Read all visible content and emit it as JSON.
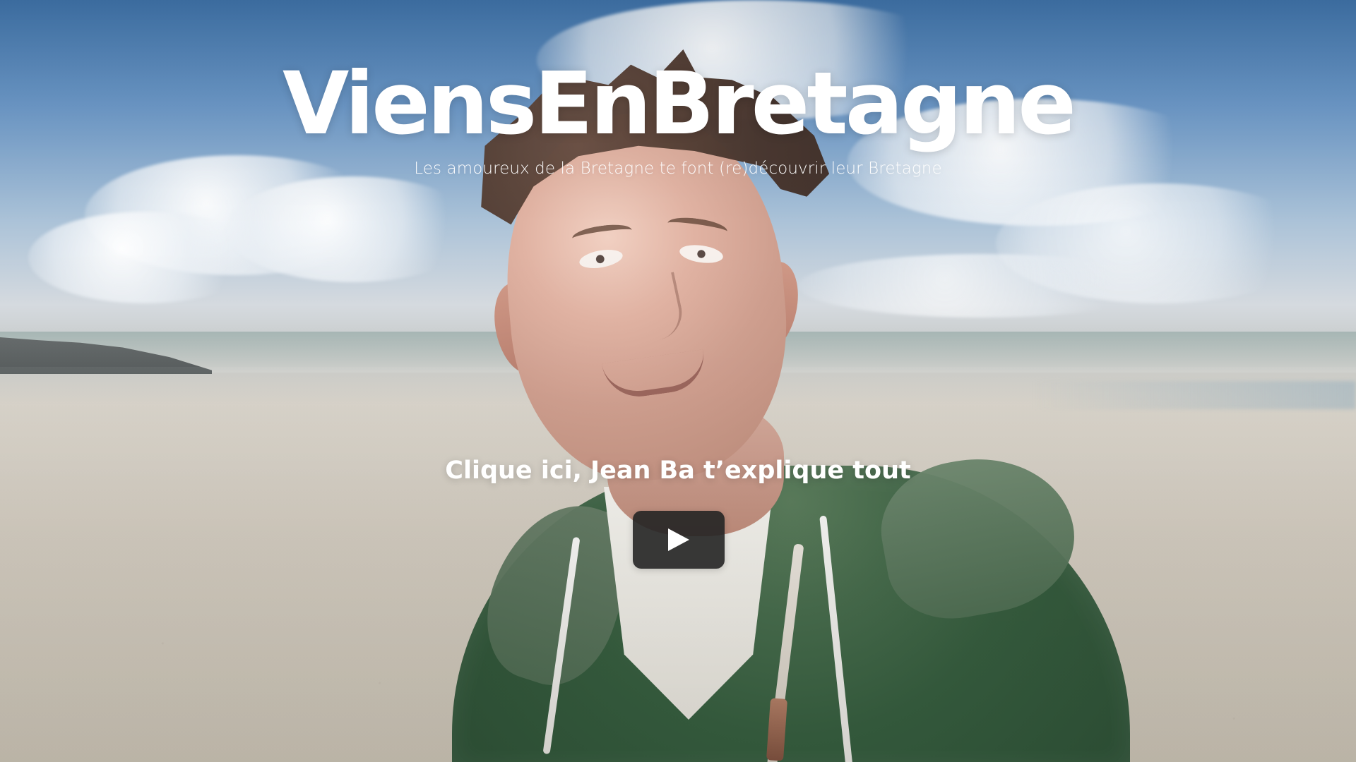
{
  "header": {
    "title": "ViensEnBretagne",
    "subtitle": "Les amoureux de la Bretagne te font (re)découvrir leur Bretagne"
  },
  "hero": {
    "cta_label": "Clique ici, Jean Ba t’explique tout",
    "play_icon": "play-icon",
    "colors": {
      "text": "#ffffff",
      "button": "#232323"
    }
  }
}
